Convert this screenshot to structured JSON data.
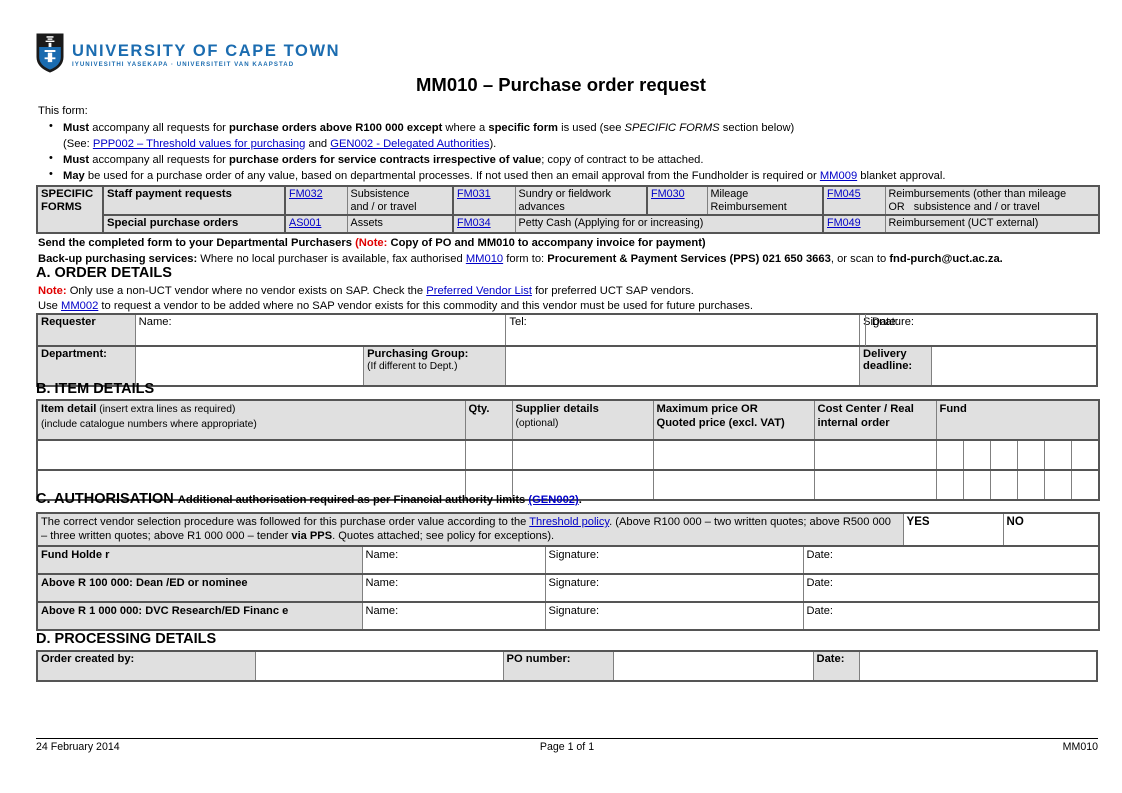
{
  "logo": {
    "main": "UNIVERSITY OF CAPE TOWN",
    "sub": "IYUNIVESITHI YASEKAPA · UNIVERSITEIT VAN KAAPSTAD",
    "icon": "uct-shield-icon",
    "color": "#1b6cb0"
  },
  "title": "MM010 – Purchase order request",
  "intro": {
    "lead": "This form:",
    "b1_strong": "Must",
    "b1_a": " accompany all requests for ",
    "b1_strong2": "purchase orders above R100 000 except",
    "b1_b": " where a ",
    "b1_strong3": "specific form",
    "b1_c": " is used (see ",
    "b1_em": "SPECIFIC FORMS",
    "b1_d": " section below)",
    "b1_see": "(See: ",
    "link_ppp002": "PPP002 – Threshold values for purchasing",
    "b1_and": " and ",
    "link_gen002": "GEN002 - Delegated Authorities",
    "b1_end": ").",
    "b2_strong": "Must",
    "b2_a": " accompany all requests for ",
    "b2_strong2": "purchase orders for service contracts irrespective of value",
    "b2_b": "; copy of contract to be attached.",
    "b3_strong": "May",
    "b3_a": " be used for a purchase order of any value, based on departmental processes. If not used then an email approval from the Fundholder is required or ",
    "link_mm009": "MM009",
    "b3_b": " blanket approval."
  },
  "specific_forms": {
    "label": "SPECIFIC FORMS",
    "rows": [
      {
        "label": "Staff payment requests",
        "items": [
          {
            "code": "FM032",
            "desc": "Subsistence\nand / or travel"
          },
          {
            "code": "FM031",
            "desc": "Sundry or fieldwork\nadvances"
          },
          {
            "code": "FM030",
            "desc": "Mileage\nReimbursement"
          },
          {
            "code": "FM045",
            "desc": "Reimbursements (other than mileage\nOR   subsistence and / or travel"
          }
        ]
      },
      {
        "label": "Special purchase orders",
        "items": [
          {
            "code": "AS001",
            "desc": "Assets"
          },
          {
            "code": "FM034",
            "desc": "Petty Cash (Applying for or increasing)"
          },
          {
            "code": "FM049",
            "desc": "Reimbursement (UCT external)"
          }
        ]
      }
    ]
  },
  "send_line": {
    "a": "Send the completed form to your Departmental Purchasers ",
    "note": "(Note:",
    "b": " Copy of PO and MM010 to accompany invoice for payment)"
  },
  "backup_line": {
    "strong": "Back-up purchasing services:",
    "a": " Where no local purchaser is available, fax authorised ",
    "link_mm010": "MM010",
    "b": " form to: ",
    "strong2": "Procurement & Payment Services (PPS) 021 650 3663",
    "c": ", or scan to ",
    "strong3": "fnd-purch@uct.ac.za."
  },
  "section_a": {
    "heading": "A. ORDER DETAILS",
    "note_label": "Note:",
    "note_a": " Only use a non-UCT vendor where no vendor exists on SAP. Check the ",
    "link_pvl": "Preferred Vendor List",
    "note_b": " for preferred UCT SAP vendors.",
    "use_a": "Use ",
    "link_mm002": "MM002",
    "use_b": " to request a vendor to be added where no SAP vendor exists for this commodity and this vendor must be used for future purchases.",
    "requester_label": "Requester",
    "name_label": "Name:",
    "tel_label": "Tel:",
    "signature_label": "Signature:",
    "date_label": "Date:",
    "department_label": "Department:",
    "purchasing_group_label": "Purchasing Group:",
    "purchasing_group_sub": "(If different to Dept.)",
    "delivery_deadline_label": "Delivery\ndeadline:",
    "values": {
      "name": "",
      "tel": "",
      "signature": "",
      "date": "",
      "department": "",
      "purchasing_group": "",
      "delivery_deadline": ""
    }
  },
  "section_b": {
    "heading": "B. ITEM DETAILS",
    "headers": {
      "item_detail_strong": "Item detail",
      "item_detail_light": " (insert extra lines as required)",
      "item_detail_line2": "(include catalogue numbers where appropriate)",
      "qty": "Qty.",
      "supplier_strong": "Supplier details",
      "supplier_light": "(optional)",
      "max_price_l1": "Maximum price OR",
      "max_price_l2": "Quoted price  (excl. VAT)",
      "cost_center_l1": "Cost Center / Real",
      "cost_center_l2": "internal order",
      "fund": "Fund"
    },
    "fund_subcells": 6,
    "rows": [
      {
        "item_detail": "",
        "qty": "",
        "supplier": "",
        "price": "",
        "cost_center": "",
        "fund": [
          "",
          "",
          "",
          "",
          "",
          ""
        ]
      },
      {
        "item_detail": "",
        "qty": "",
        "supplier": "",
        "price": "",
        "cost_center": "",
        "fund": [
          "",
          "",
          "",
          "",
          "",
          ""
        ]
      }
    ]
  },
  "section_c": {
    "heading": "C. AUTHORISATION",
    "heading_sub_a": "Additional  authorisation required as per Financial authority limits   ",
    "link_gen002": "(GEN002)",
    "heading_sub_b": ".",
    "statement_a": "The correct vendor selection procedure was followed for this  purchase order value according to the ",
    "link_threshold": "Threshold policy",
    "statement_b": ". (Above R100 000 – two written quotes; above R500 000 – three written quotes;  above R1 000 000 – tender ",
    "statement_strong": "via PPS",
    "statement_c": ". Quotes attached; see policy for exceptions).",
    "yes": "YES",
    "no": "NO",
    "name_label": "Name:",
    "signature_label": "Signature:",
    "date_label": "Date:",
    "rows": [
      {
        "label": "Fund Holde r",
        "name": "",
        "signature": "",
        "date": ""
      },
      {
        "label": "Above R 100 000:  Dean /ED  or nominee",
        "name": "",
        "signature": "",
        "date": ""
      },
      {
        "label": "Above R 1 000 000: DVC Research/ED Financ e",
        "name": "",
        "signature": "",
        "date": ""
      }
    ]
  },
  "section_d": {
    "heading": "D. PROCESSING DETAILS",
    "order_created_label": "Order created by:",
    "po_number_label": "PO number:",
    "date_label": "Date:",
    "values": {
      "order_created_by": "",
      "po_number": "",
      "date": ""
    }
  },
  "footer": {
    "left": "24 February 2014",
    "center": "Page 1 of 1",
    "right": "MM010"
  }
}
